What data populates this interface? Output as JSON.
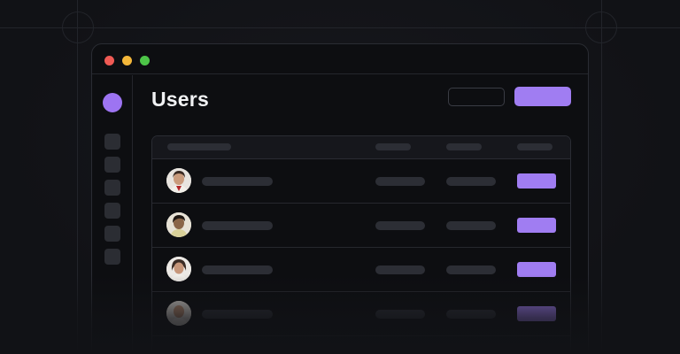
{
  "window": {
    "traffic_lights": [
      "#ef5a54",
      "#f3b73a",
      "#4dc548"
    ]
  },
  "page": {
    "title": "Users"
  },
  "colors": {
    "accent": "#a07df2",
    "placeholder": "#2c2e35",
    "background": "#111216"
  },
  "table": {
    "rows": [
      {
        "avatar": "user-avatar-1"
      },
      {
        "avatar": "user-avatar-2"
      },
      {
        "avatar": "user-avatar-3"
      },
      {
        "avatar": "user-avatar-4"
      }
    ]
  }
}
